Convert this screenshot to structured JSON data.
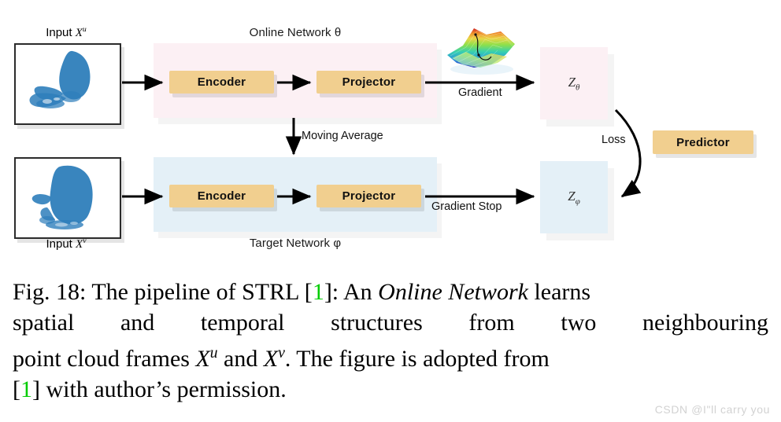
{
  "figure": {
    "online_panel_caption": "Online Network θ",
    "target_panel_caption": "Target Network φ",
    "modules": {
      "online_encoder": "Encoder",
      "online_projector": "Projector",
      "target_encoder": "Encoder",
      "target_projector": "Projector",
      "predictor": "Predictor"
    },
    "inputs": {
      "top_label_prefix": "Input ",
      "top_label_var": "X",
      "top_label_sup": "u",
      "bottom_label_prefix": "Input ",
      "bottom_label_var": "X",
      "bottom_label_sup": "v"
    },
    "outputs": {
      "z_theta_base": "Z",
      "z_theta_sub": "θ",
      "z_phi_base": "Z",
      "z_phi_sub": "φ"
    },
    "edges": {
      "gradient": "Gradient",
      "gradient_stop": "Gradient Stop",
      "moving_average": "Moving Average",
      "loss": "Loss"
    },
    "icons": {
      "loss_surface": "loss-landscape-surface-icon",
      "point_cloud_top": "point-cloud-icon",
      "point_cloud_bottom": "point-cloud-icon"
    },
    "colors": {
      "online_panel": "#fcf0f4",
      "target_panel": "#e4f0f7",
      "module_fill": "#f1cf8f",
      "point_cloud_blue": "#2e7ebb",
      "reference_green": "#00cc00",
      "arrow_black": "#000000",
      "watermark_gray": "#d2d2d2"
    }
  },
  "caption": {
    "line1_a": "Fig. 18: The pipeline of STRL [",
    "line1_ref": "1",
    "line1_b": "]: An ",
    "line1_em": "Online Network",
    "line1_c": " learns",
    "line2_words": [
      "spatial",
      "and",
      "temporal",
      "structures",
      "from",
      "two",
      "neighbouring"
    ],
    "line3_a": "point cloud frames ",
    "line3_var1": "X",
    "line3_sup1": "u",
    "line3_b": " and ",
    "line3_var2": "X",
    "line3_sup2": "v",
    "line3_c": ". The figure is adopted from",
    "line4_a": "[",
    "line4_ref": "1",
    "line4_b": "] with author’s permission."
  },
  "watermark": {
    "text": "CSDN @I\"ll  carry  you"
  }
}
